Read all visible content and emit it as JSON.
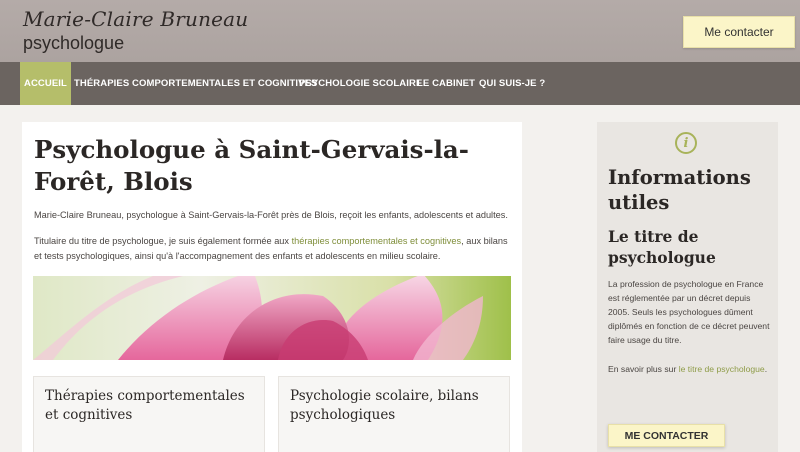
{
  "header": {
    "name": "Marie-Claire Bruneau",
    "subtitle": "psychologue",
    "contact_button": "Me contacter"
  },
  "nav": {
    "items": [
      {
        "label": "ACCUEIL",
        "active": true
      },
      {
        "label": "THÉRAPIES COMPORTEMENTALES ET COGNITIVES",
        "active": false
      },
      {
        "label": "PSYCHOLOGIE SCOLAIRE",
        "active": false
      },
      {
        "label": "LE CABINET",
        "active": false
      },
      {
        "label": "QUI SUIS-JE ?",
        "active": false
      }
    ]
  },
  "main": {
    "title": "Psychologue à Saint-Gervais-la-Forêt, Blois",
    "intro": "Marie-Claire Bruneau, psychologue à Saint-Gervais-la-Forêt près de Blois, reçoit les enfants, adolescents et adultes.",
    "para2_before": "Titulaire du titre de psychologue, je suis également formée aux ",
    "para2_link": "thérapies comportementales et cognitives",
    "para2_after": ", aux bilans et tests psychologiques, ainsi qu'à l'accompagnement des enfants et adolescents en milieu scolaire.",
    "cards": [
      {
        "title": "Thérapies comportementales et cognitives"
      },
      {
        "title": "Psychologie scolaire, bilans psychologiques"
      }
    ]
  },
  "aside": {
    "icon": "info-icon",
    "heading": "Informations utiles",
    "subheading": "Le titre de psychologue",
    "text": "La profession de psychologue en France est réglementée par un décret depuis 2005. Seuls les psychologues dûment diplômés en fonction de ce décret peuvent faire usage du titre.",
    "more_before": "En savoir plus sur ",
    "more_link": "le titre de psychologue",
    "more_after": ".",
    "button": "ME CONTACTER"
  },
  "colors": {
    "accent": "#b5be6a",
    "link": "#7f8e3a",
    "nav_bg": "#6b6460",
    "header_bg": "#b0a7a4",
    "button_bg": "#fbf5c8"
  }
}
